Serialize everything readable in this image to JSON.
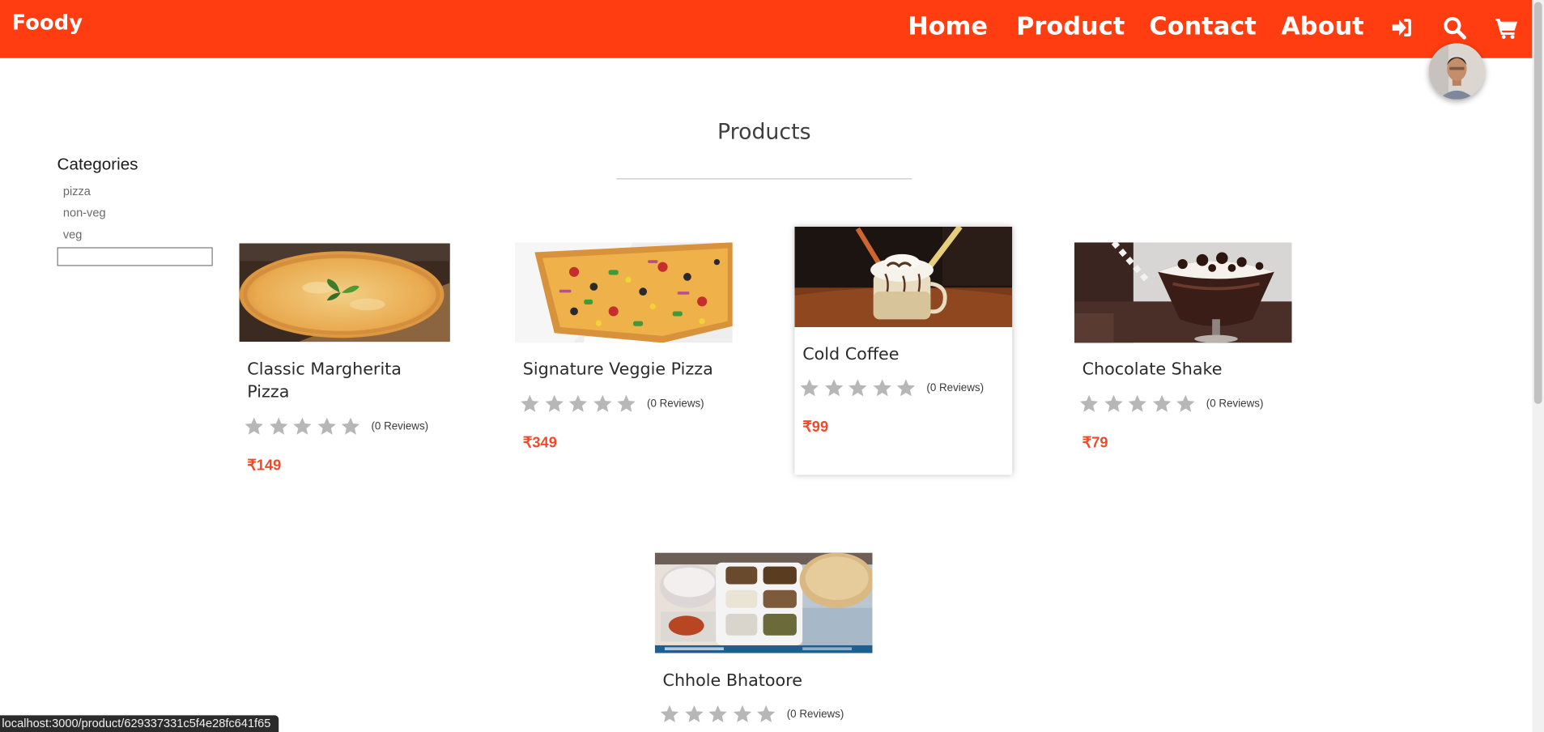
{
  "header": {
    "brand": "Foody",
    "nav": {
      "home": "Home",
      "product": "Product",
      "contact": "Contact",
      "about": "About"
    },
    "icons": {
      "login": "sign-in-icon",
      "search": "search-icon",
      "cart": "shopping-cart-icon"
    },
    "bg_color": "#ff3d10"
  },
  "page": {
    "title": "Products"
  },
  "sidebar": {
    "title": "Categories",
    "categories": [
      "pizza",
      "non-veg",
      "veg"
    ],
    "search_value": ""
  },
  "products": [
    {
      "name": "Classic Margherita Pizza",
      "rating": 0,
      "reviews": "(0 Reviews)",
      "price": "₹149",
      "image": "pizza-margherita-photo"
    },
    {
      "name": "Signature Veggie Pizza",
      "rating": 0,
      "reviews": "(0 Reviews)",
      "price": "₹349",
      "image": "veggie-pizza-photo"
    },
    {
      "name": "Cold Coffee",
      "rating": 0,
      "reviews": "(0 Reviews)",
      "price": "₹99",
      "image": "cold-coffee-photo"
    },
    {
      "name": "Chocolate Shake",
      "rating": 0,
      "reviews": "(0 Reviews)",
      "price": "₹79",
      "image": "chocolate-shake-photo"
    },
    {
      "name": "Chhole Bhatoore",
      "rating": 0,
      "reviews": "(0 Reviews)",
      "price": "",
      "image": "chhole-bhatoore-photo"
    }
  ],
  "status_bar": {
    "url": "localhost:3000/product/629337331c5f4e28fc641f65"
  },
  "colors": {
    "accent": "#ff3d10",
    "price": "#f04a2a",
    "star_empty": "#b7b7b7"
  }
}
